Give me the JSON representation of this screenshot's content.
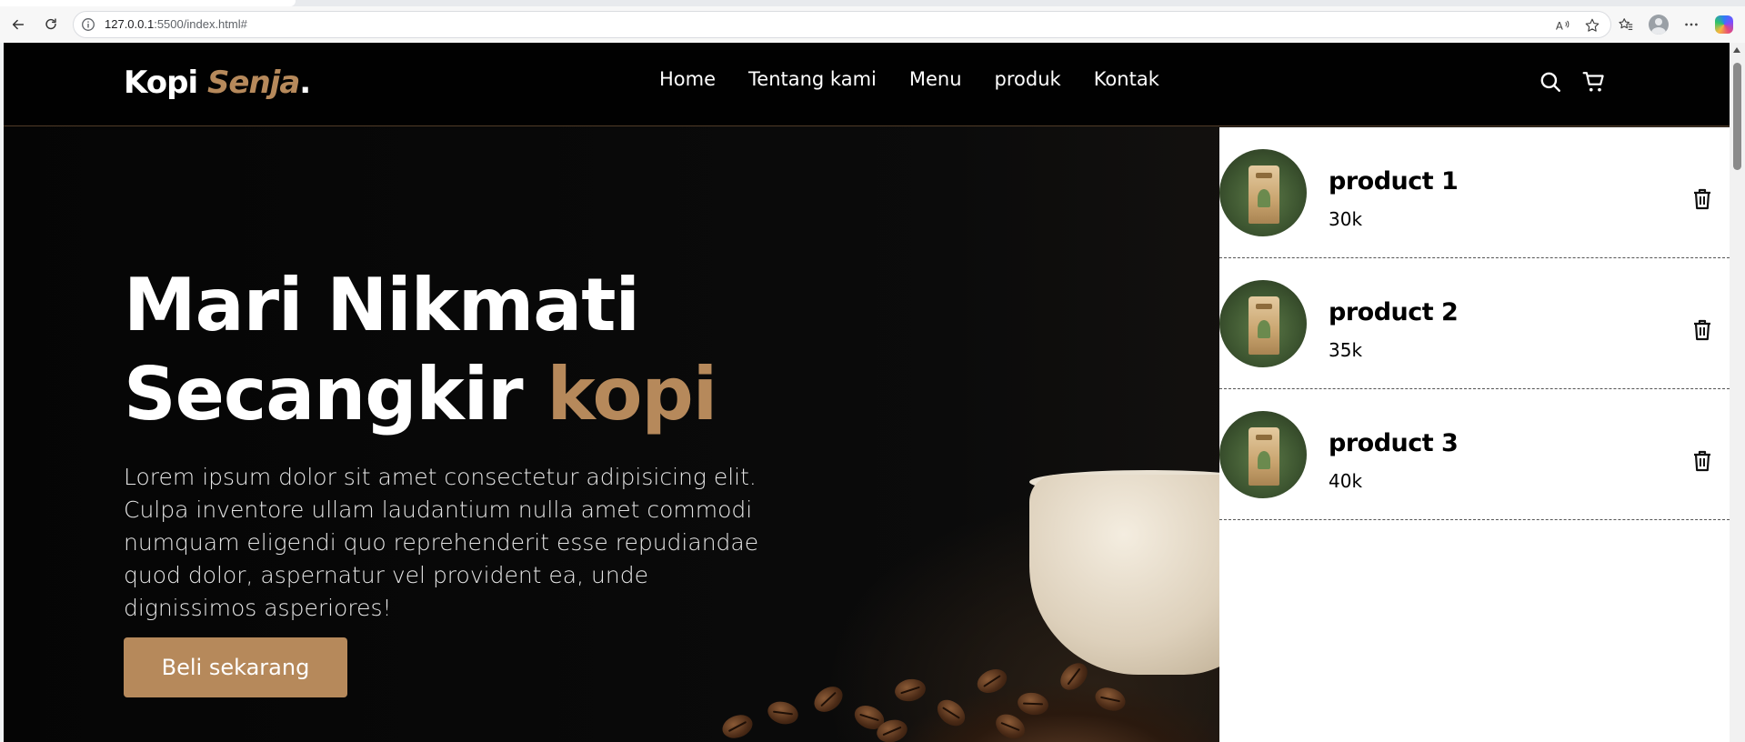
{
  "browser": {
    "url_host": "127.0.0.1",
    "url_rest": ":5500/index.html#"
  },
  "navbar": {
    "logo_main": "Kopi ",
    "logo_accent": "Senja",
    "logo_dot": ".",
    "links": [
      "Home",
      "Tentang kami",
      "Menu",
      "produk",
      "Kontak"
    ],
    "icons": [
      "search-icon",
      "cart-icon"
    ]
  },
  "hero": {
    "title_line1": "Mari Nikmati",
    "title_line2": "Secangkir ",
    "title_accent": "kopi",
    "text": "Lorem ipsum dolor sit amet consectetur adipisicing elit. Culpa inventore ullam laudantium nulla amet commodi numquam eligendi quo reprehenderit esse repudiandae quod dolor, aspernatur vel provident ea, unde dignissimos asperiores!",
    "cta_label": "Beli sekarang"
  },
  "cart": {
    "items": [
      {
        "name": "product 1",
        "price": "30k"
      },
      {
        "name": "product 2",
        "price": "35k"
      },
      {
        "name": "product 3",
        "price": "40k"
      }
    ]
  },
  "colors": {
    "accent": "#b6895b",
    "background": "#010101",
    "panel": "#ffffff"
  }
}
